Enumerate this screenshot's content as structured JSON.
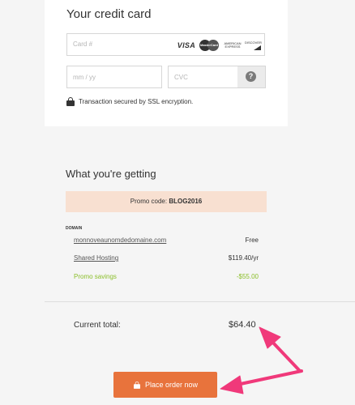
{
  "card_section": {
    "title": "Your credit card",
    "card_number_placeholder": "Card #",
    "brands": {
      "visa": "VISA",
      "mastercard": "MasterCard",
      "amex": "AMERICAN EXPRESS",
      "discover": "DISCOVER"
    },
    "expiry_placeholder": "mm / yy",
    "cvc_placeholder": "CVC",
    "help_icon": "?",
    "ssl_text": "Transaction secured by SSL encryption."
  },
  "order_summary": {
    "title": "What you're getting",
    "promo_label": "Promo code:",
    "promo_code": "BLOG2016",
    "domain_heading": "DOMAIN",
    "items": [
      {
        "label": "monnoveaunomdedomaine.com",
        "value": "Free"
      },
      {
        "label": "Shared Hosting",
        "value": "$119.40/yr"
      },
      {
        "label": "Promo savings",
        "value": "-$55.00"
      }
    ],
    "total_label": "Current total:",
    "total_value": "$64.40"
  },
  "button": {
    "label": "Place order now"
  },
  "colors": {
    "accent": "#e8733c",
    "promo_bg": "#f8e0d1",
    "savings": "#8bbf2a",
    "annotation_arrow": "#f0397a"
  }
}
